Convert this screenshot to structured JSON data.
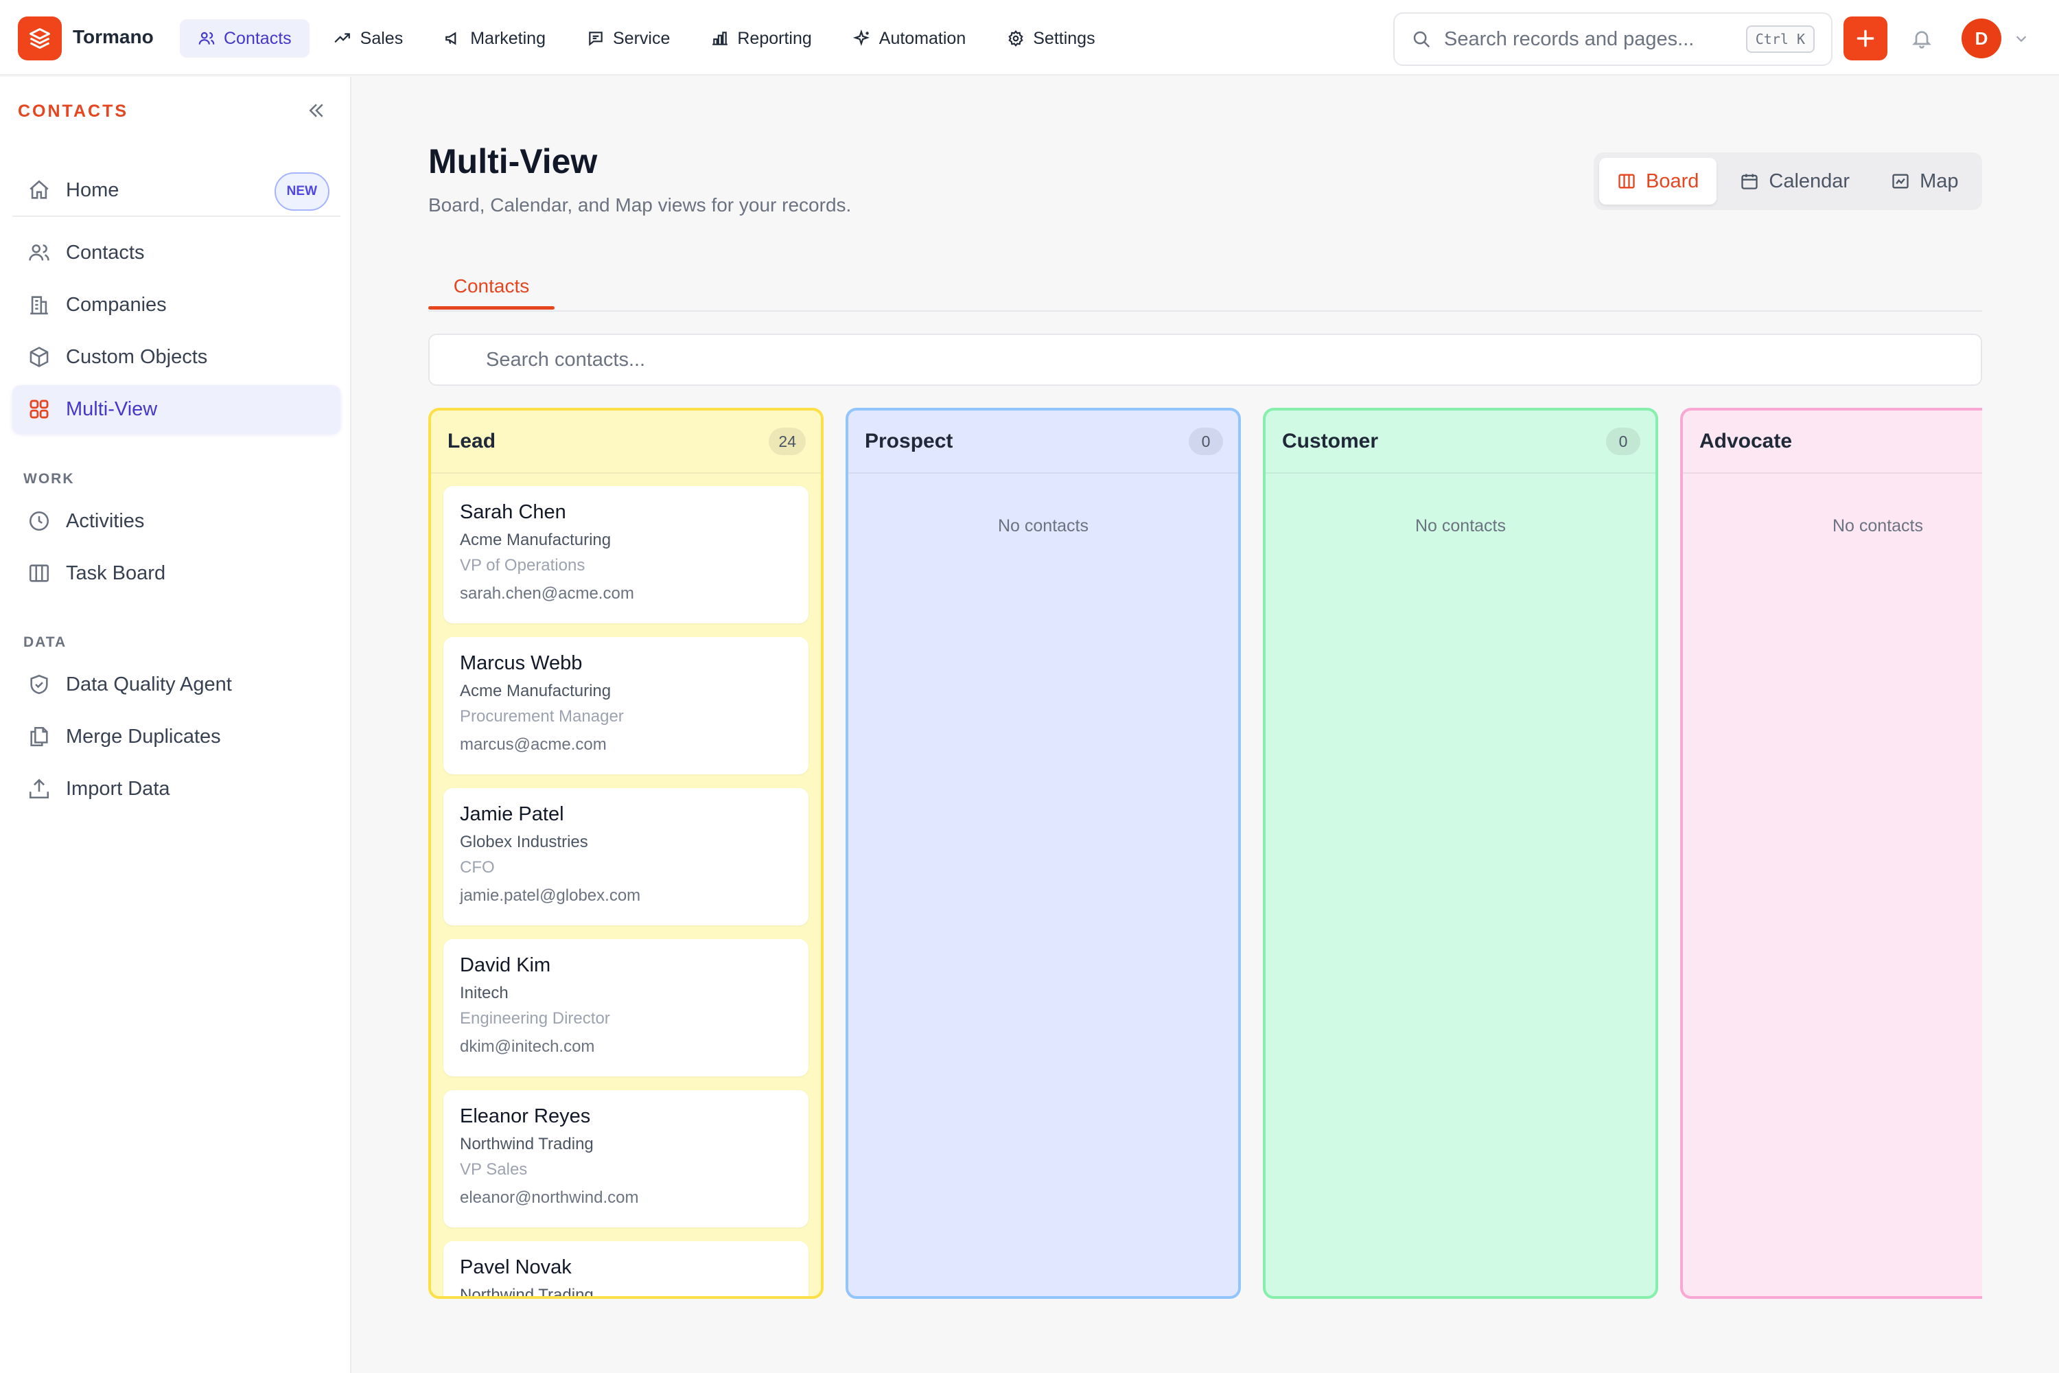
{
  "app": {
    "name": "Tormano",
    "brand_color": "#f0441b"
  },
  "topnav": [
    {
      "label": "Contacts",
      "icon": "users-icon",
      "active": true
    },
    {
      "label": "Sales",
      "icon": "trending-up-icon"
    },
    {
      "label": "Marketing",
      "icon": "megaphone-icon"
    },
    {
      "label": "Service",
      "icon": "chat-icon"
    },
    {
      "label": "Reporting",
      "icon": "bar-chart-icon"
    },
    {
      "label": "Automation",
      "icon": "sparkle-icon"
    },
    {
      "label": "Settings",
      "icon": "gear-icon"
    }
  ],
  "search": {
    "placeholder": "Search records and pages...",
    "shortcut": "Ctrl K"
  },
  "user": {
    "initial": "D"
  },
  "sidebar": {
    "title": "CONTACTS",
    "home": {
      "label": "Home",
      "badge": "NEW"
    },
    "items": [
      {
        "label": "Contacts",
        "icon": "users-icon"
      },
      {
        "label": "Companies",
        "icon": "building-icon"
      },
      {
        "label": "Custom Objects",
        "icon": "cube-icon"
      },
      {
        "label": "Multi-View",
        "icon": "grid-icon",
        "active": true
      }
    ],
    "work_title": "WORK",
    "work": [
      {
        "label": "Activities",
        "icon": "clock-icon"
      },
      {
        "label": "Task Board",
        "icon": "columns-icon"
      }
    ],
    "data_title": "DATA",
    "data": [
      {
        "label": "Data Quality Agent",
        "icon": "shield-check-icon"
      },
      {
        "label": "Merge Duplicates",
        "icon": "copy-icon"
      },
      {
        "label": "Import Data",
        "icon": "upload-icon"
      }
    ]
  },
  "page": {
    "title": "Multi-View",
    "subtitle": "Board, Calendar, and Map views for your records."
  },
  "views": [
    {
      "label": "Board",
      "icon": "board-icon",
      "active": true
    },
    {
      "label": "Calendar",
      "icon": "calendar-icon"
    },
    {
      "label": "Map",
      "icon": "map-icon"
    }
  ],
  "tabs": [
    {
      "label": "Contacts",
      "active": true
    }
  ],
  "contact_search": {
    "placeholder": "Search contacts..."
  },
  "columns": [
    {
      "title": "Lead",
      "count": "24",
      "bg": "#fef9c3",
      "border": "#fde047",
      "cards": [
        {
          "name": "Sarah Chen",
          "company": "Acme Manufacturing",
          "role": "VP of Operations",
          "email": "sarah.chen@acme.com"
        },
        {
          "name": "Marcus Webb",
          "company": "Acme Manufacturing",
          "role": "Procurement Manager",
          "email": "marcus@acme.com"
        },
        {
          "name": "Jamie Patel",
          "company": "Globex Industries",
          "role": "CFO",
          "email": "jamie.patel@globex.com"
        },
        {
          "name": "David Kim",
          "company": "Initech",
          "role": "Engineering Director",
          "email": "dkim@initech.com"
        },
        {
          "name": "Eleanor Reyes",
          "company": "Northwind Trading",
          "role": "VP Sales",
          "email": "eleanor@northwind.com"
        },
        {
          "name": "Pavel Novak",
          "company": "Northwind Trading",
          "role": "",
          "email": ""
        }
      ]
    },
    {
      "title": "Prospect",
      "count": "0",
      "bg": "#e0e7ff",
      "border": "#93c5fd",
      "empty": "No contacts",
      "cards": []
    },
    {
      "title": "Customer",
      "count": "0",
      "bg": "#d1fae5",
      "border": "#86efac",
      "empty": "No contacts",
      "cards": []
    },
    {
      "title": "Advocate",
      "count": "",
      "bg": "#fce7f3",
      "border": "#f9a8d4",
      "empty": "No contacts",
      "cards": []
    }
  ]
}
